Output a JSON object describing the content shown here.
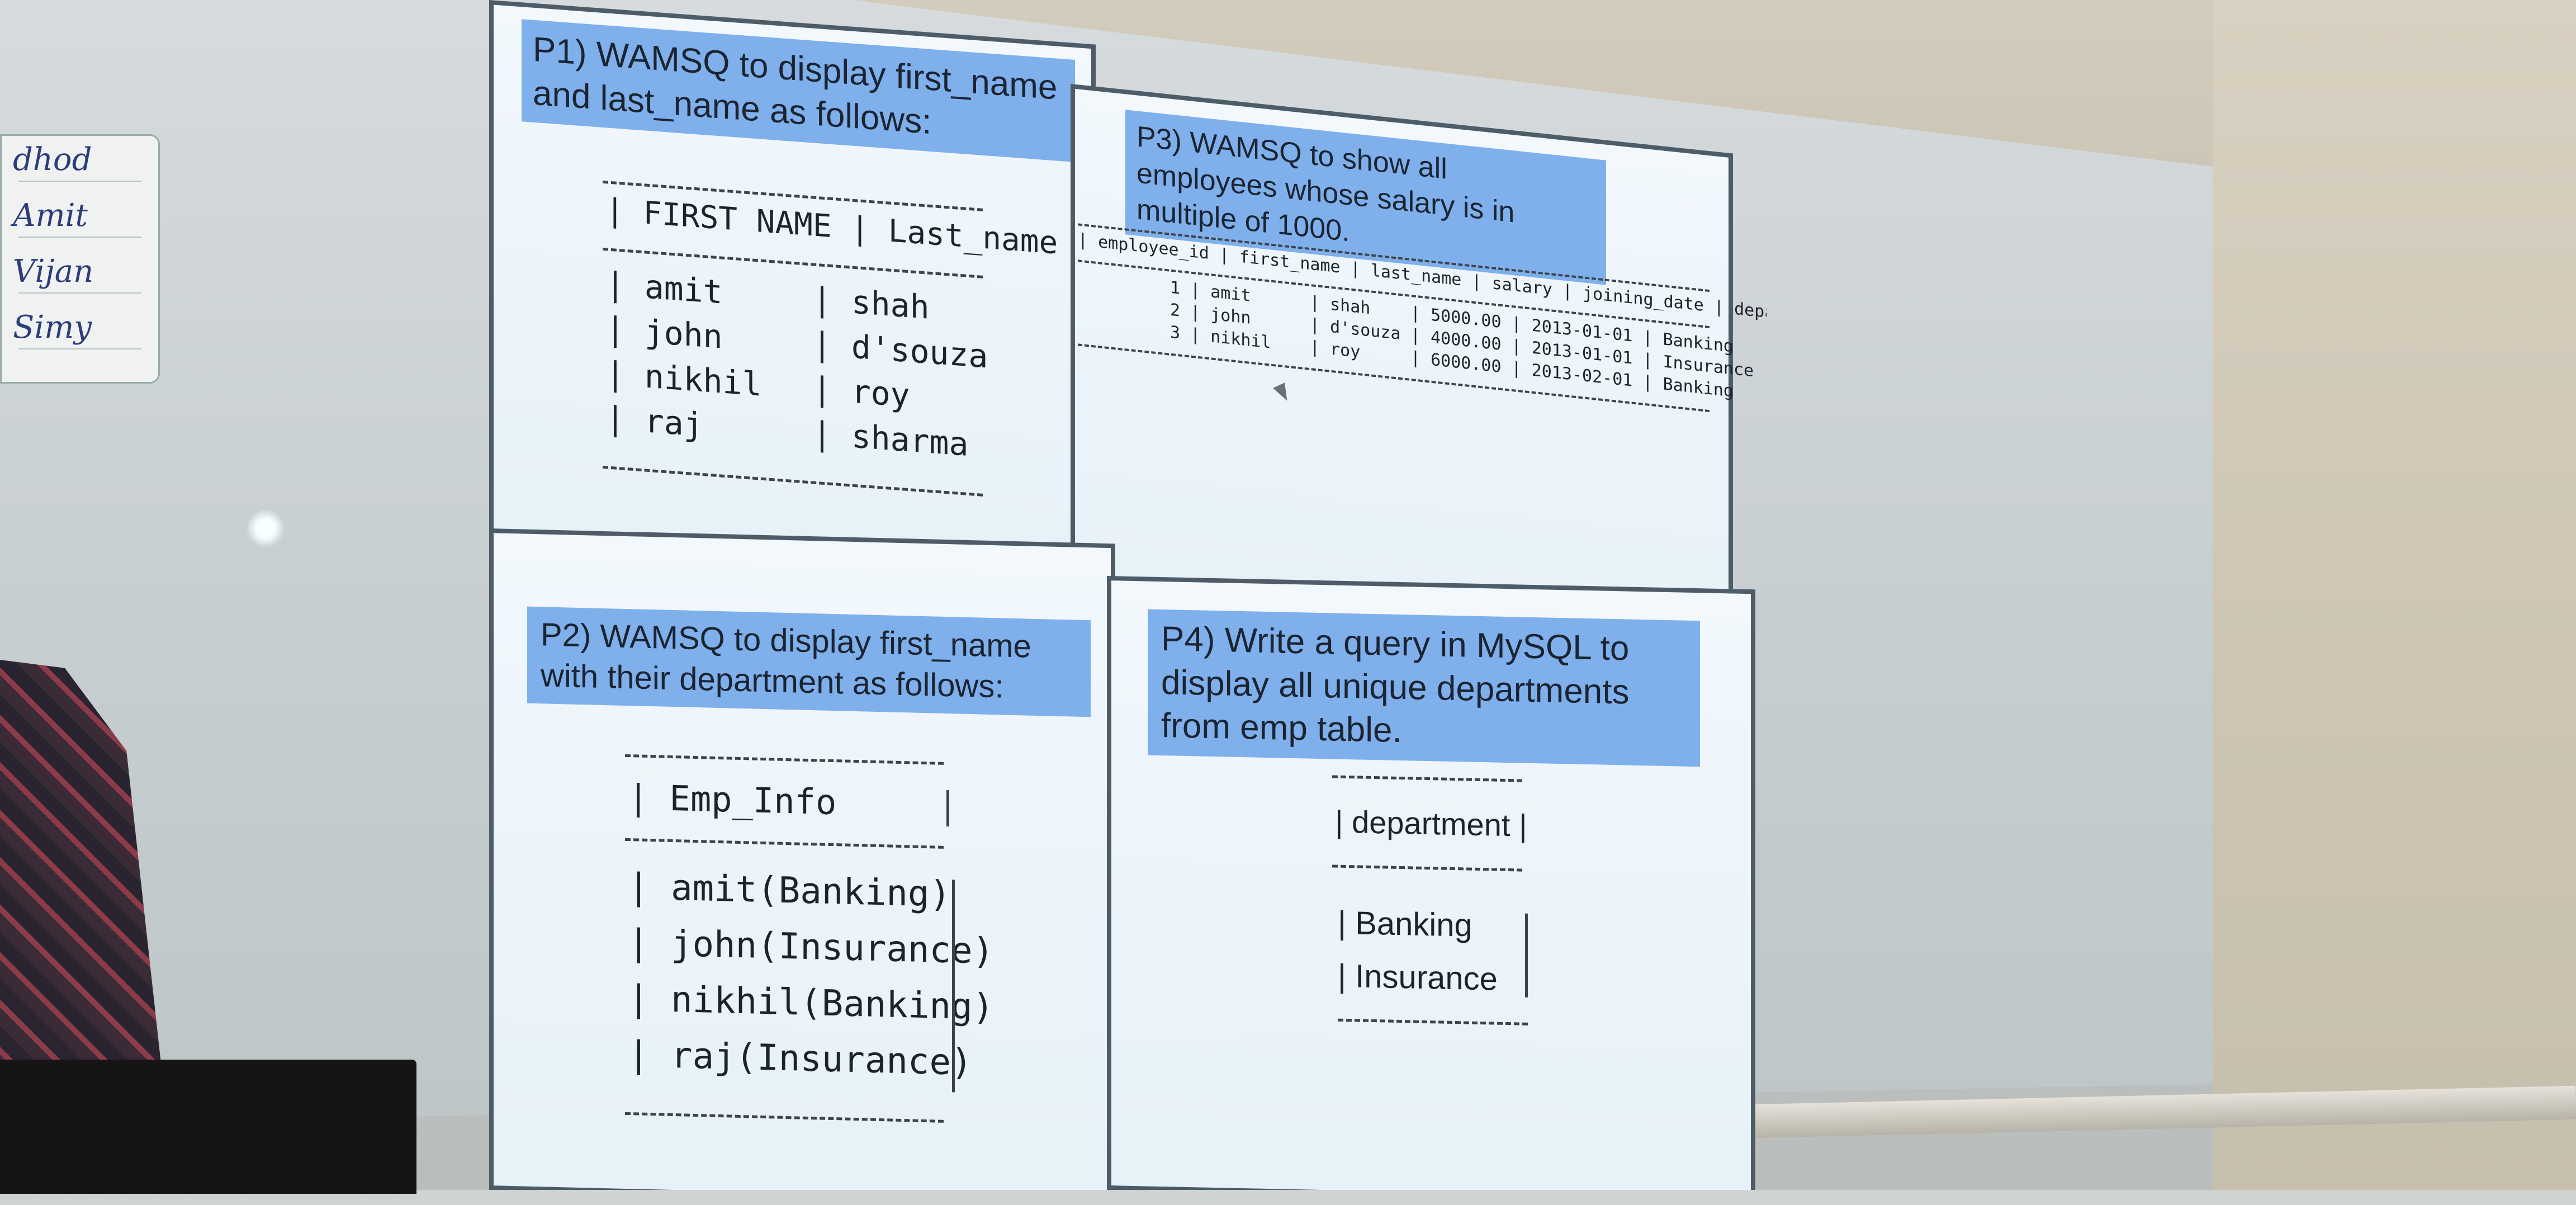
{
  "hand_list": [
    "dhod",
    "Amit",
    "Vijan",
    "Simy"
  ],
  "p1": {
    "question": "P1) WAMSQ to display first_name and last_name as follows:",
    "headers": [
      "FIRST NAME",
      "Last_name"
    ],
    "rows": [
      [
        "amit",
        "shah"
      ],
      [
        "john",
        "d'souza"
      ],
      [
        "nikhil",
        "roy"
      ],
      [
        "raj",
        "sharma"
      ]
    ]
  },
  "p2": {
    "question": "P2) WAMSQ to display first_name with their department as follows:",
    "header": "Emp_Info",
    "rows": [
      "amit(Banking)",
      "john(Insurance)",
      "nikhil(Banking)",
      "raj(Insurance)"
    ]
  },
  "p3": {
    "question": "P3) WAMSQ to show all employees whose salary is in multiple of 1000.",
    "headers": [
      "employee_id",
      "first_name",
      "last_name",
      "salary",
      "joining_date",
      "department"
    ],
    "rows": [
      [
        "1",
        "amit",
        "shah",
        "5000.00",
        "2013-01-01",
        "Banking"
      ],
      [
        "2",
        "john",
        "d'souza",
        "4000.00",
        "2013-01-01",
        "Insurance"
      ],
      [
        "3",
        "nikhil",
        "roy",
        "6000.00",
        "2013-02-01",
        "Banking"
      ]
    ]
  },
  "p4": {
    "question": "P4) Write a query in MySQL to display all unique departments from emp table.",
    "header": "department",
    "rows": [
      "Banking",
      "Insurance"
    ]
  }
}
